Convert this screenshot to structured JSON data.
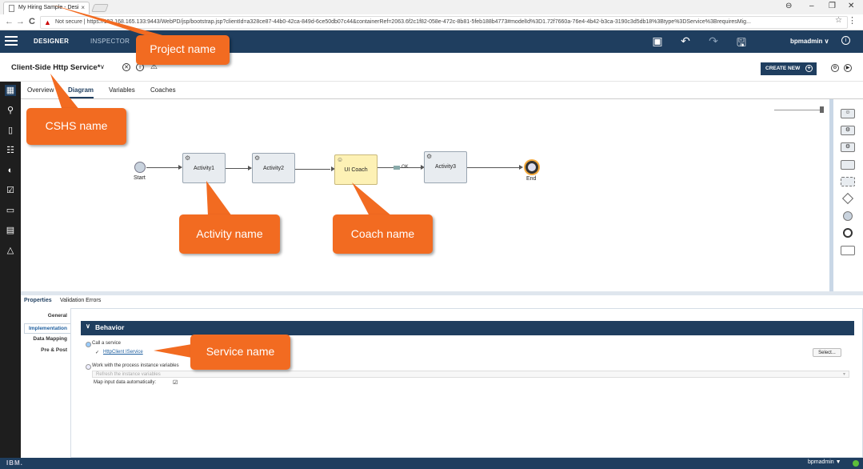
{
  "browser": {
    "tab_title": "My Hiring Sample - Desi",
    "tab_close": "×",
    "url": "Not secure | https://192.168.165.133:9443/WebPD/jsp/bootstrap.jsp?clientId=a328ce87-44b0-42ca-849d-6ce50db07c44&containerRef=2063.6f2c1f82-058e-472c-8b81-5feb188b4773#modelId%3D1.72f7660a-76e4-4b42-b3ca-3190c3d5db18%3Btype%3DService%3BrequiresMig...",
    "back": "←",
    "forward": "→",
    "reload": "C",
    "window_controls": [
      "⊖",
      "–",
      "❐",
      "✕"
    ]
  },
  "appbar": {
    "designer": "DESIGNER",
    "inspector": "INSPECTOR",
    "user": "bpmadmin ∨",
    "info": "i"
  },
  "titlebar": {
    "title": "Client-Side Http Service*",
    "dropdown": "∨",
    "create_new": "CREATE NEW",
    "create_new_plus": "+"
  },
  "subtabs": {
    "overview": "Overview",
    "diagram": "Diagram",
    "variables": "Variables",
    "coaches": "Coaches"
  },
  "diagram": {
    "start_label": "Start",
    "end_label": "End",
    "activity1": "Activity1",
    "activity2": "Activity2",
    "ui_coach": "UI Coach",
    "activity3": "Activity3",
    "ok_label": "OK"
  },
  "properties": {
    "tab_properties": "Properties",
    "tab_validation": "Validation Errors",
    "nav_general": "General",
    "nav_implementation": "Implementation",
    "nav_data_mapping": "Data Mapping",
    "nav_pre_post": "Pre & Post",
    "behavior_header": "Behavior",
    "call_service": "Call a service",
    "service_link": "HttpClient IService",
    "select_button": "Select...",
    "work_with_vars": "Work with the process instance variables",
    "refresh_vars": "Refresh the instance variables",
    "map_input": "Map input data automatically:"
  },
  "statusbar": {
    "ibm": "IBM.",
    "user": "bpmadmin ▼"
  },
  "callouts": {
    "project_name": "Project name",
    "cshs_name": "CSHS name",
    "activity_name": "Activity name",
    "coach_name": "Coach name",
    "service_name": "Service name"
  },
  "colors": {
    "brand": "#1f3e5f",
    "callout": "#f26b21",
    "coach": "#fdf1b5"
  }
}
